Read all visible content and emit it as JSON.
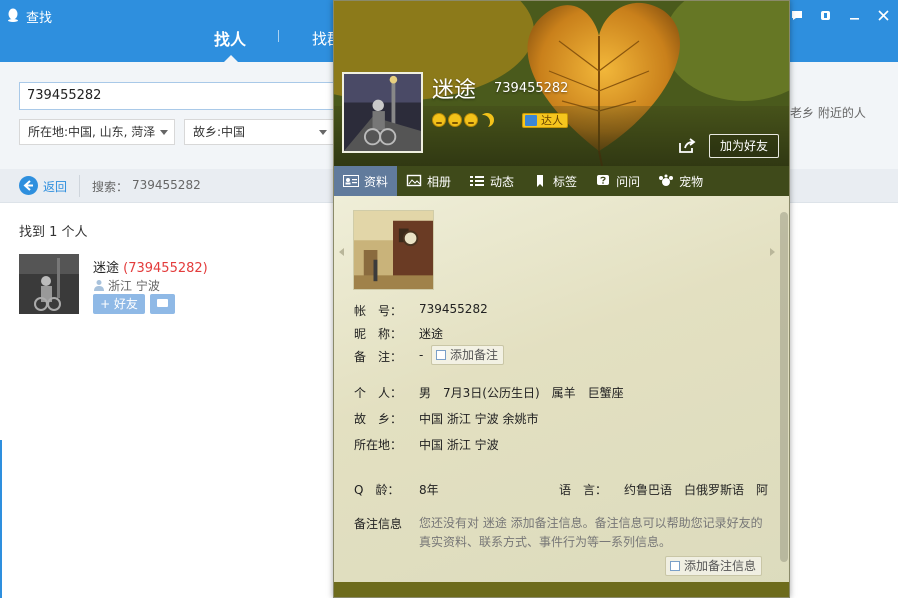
{
  "window": {
    "title": "查找",
    "tabs": [
      {
        "label": "找人",
        "active": true
      },
      {
        "label": "找群"
      }
    ],
    "controls": [
      "message-icon",
      "skin-icon",
      "minimize-icon",
      "close-icon"
    ]
  },
  "search": {
    "query": "739455282",
    "location_filter": "所在地:中国, 山东, 菏泽",
    "hometown_filter": "故乡:中国",
    "right_hint": "老乡 附近的人"
  },
  "nav": {
    "back_label": "返回",
    "crumb_label": "搜索：",
    "crumb_value": "739455282"
  },
  "results": {
    "count_text": "找到 1 个人",
    "items": [
      {
        "nickname": "迷途",
        "qq_display": "(739455282)",
        "location": "浙江 宁波",
        "add_label": "+ 好友"
      }
    ]
  },
  "profile": {
    "name": "迷途",
    "qq": "739455282",
    "badge": "达人",
    "add_friend_label": "加为好友",
    "tabs": [
      {
        "label": "资料",
        "icon": "profile-card-icon",
        "active": true
      },
      {
        "label": "相册",
        "icon": "album-icon"
      },
      {
        "label": "动态",
        "icon": "feed-list-icon"
      },
      {
        "label": "标签",
        "icon": "tag-icon"
      },
      {
        "label": "问问",
        "icon": "question-icon"
      },
      {
        "label": "宠物",
        "icon": "pet-icon"
      }
    ],
    "fields": {
      "account_label": "帐　号：",
      "account_value": "739455282",
      "nickname_label": "昵　称：",
      "nickname_value": "迷途",
      "remark_label": "备　注：",
      "remark_value": "-",
      "add_remark_label": "添加备注",
      "personal_label": "个　人：",
      "personal_value": "男　7月3日(公历生日)　属羊　巨蟹座",
      "hometown_label": "故　乡：",
      "hometown_value": "中国 浙江 宁波 余姚市",
      "location_label": "所在地：",
      "location_value": "中国 浙江 宁波",
      "qage_label": "Q　龄：",
      "qage_value": "8年",
      "language_label": "语　言：",
      "language_value": "约鲁巴语　白俄罗斯语　阿",
      "note_info_label": "备注信息",
      "note_info_text": "您还没有对 迷途 添加备注信息。备注信息可以帮助您记录好友的真实资料、联系方式、事件行为等一系列信息。",
      "add_note_info_label": "添加备注信息"
    }
  },
  "colors": {
    "qq_blue": "#2e8fde",
    "qq_number_red": "#e33c3c",
    "panel_tab_bar": "#3f4a1a"
  }
}
